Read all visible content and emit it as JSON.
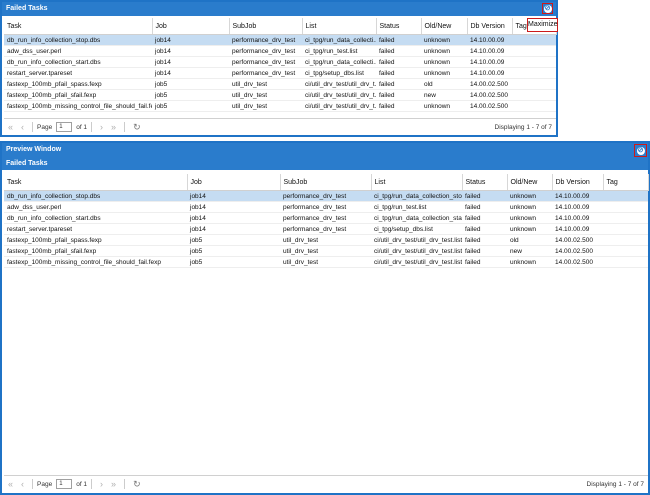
{
  "colors": {
    "accent": "#2a7ccc",
    "highlight": "#cc1a1a",
    "selected_row": "#c5dcf2"
  },
  "icons": {
    "close": "close-icon",
    "first": "first-page-icon",
    "prev": "prev-page-icon",
    "next": "next-page-icon",
    "last": "last-page-icon",
    "refresh": "refresh-icon"
  },
  "window1": {
    "title": "Failed Tasks",
    "tooltip": "Maximize",
    "columns": [
      "Task",
      "Job",
      "SubJob",
      "List",
      "Status",
      "Old/New",
      "Db Version",
      "Tag"
    ],
    "rows": [
      [
        "db_run_info_collection_stop.dbs",
        "job14",
        "performance_drv_test",
        "ci_tpg/run_data_collecti...",
        "failed",
        "unknown",
        "14.10.00.09",
        ""
      ],
      [
        "adw_dss_user.perl",
        "job14",
        "performance_drv_test",
        "ci_tpg/run_test.list",
        "failed",
        "unknown",
        "14.10.00.09",
        ""
      ],
      [
        "db_run_info_collection_start.dbs",
        "job14",
        "performance_drv_test",
        "ci_tpg/run_data_collecti...",
        "failed",
        "unknown",
        "14.10.00.09",
        ""
      ],
      [
        "restart_server.tpareset",
        "job14",
        "performance_drv_test",
        "ci_tpg/setup_dbs.list",
        "failed",
        "unknown",
        "14.10.00.09",
        ""
      ],
      [
        "fastexp_100mb_pfail_spass.fexp",
        "job5",
        "util_drv_test",
        "ci/util_drv_test/util_drv_t...",
        "failed",
        "old",
        "14.00.02.500",
        ""
      ],
      [
        "fastexp_100mb_pfail_sfail.fexp",
        "job5",
        "util_drv_test",
        "ci/util_drv_test/util_drv_t...",
        "failed",
        "new",
        "14.00.02.500",
        ""
      ],
      [
        "fastexp_100mb_missing_control_file_should_fail.fexp",
        "job5",
        "util_drv_test",
        "ci/util_drv_test/util_drv_t...",
        "failed",
        "unknown",
        "14.00.02.500",
        ""
      ]
    ],
    "pager": {
      "page_label": "Page",
      "page_value": "1",
      "of_label": "of 1",
      "display_text": "Displaying 1 - 7 of 7"
    }
  },
  "window2": {
    "title": "Preview Window",
    "subtitle": "Failed Tasks",
    "columns": [
      "Task",
      "Job",
      "SubJob",
      "List",
      "Status",
      "Old/New",
      "Db Version",
      "Tag"
    ],
    "rows": [
      [
        "db_run_info_collection_stop.dbs",
        "job14",
        "performance_drv_test",
        "ci_tpg/run_data_collection_sto...",
        "failed",
        "unknown",
        "14.10.00.09",
        ""
      ],
      [
        "adw_dss_user.perl",
        "job14",
        "performance_drv_test",
        "ci_tpg/run_test.list",
        "failed",
        "unknown",
        "14.10.00.09",
        ""
      ],
      [
        "db_run_info_collection_start.dbs",
        "job14",
        "performance_drv_test",
        "ci_tpg/run_data_collection_sta...",
        "failed",
        "unknown",
        "14.10.00.09",
        ""
      ],
      [
        "restart_server.tpareset",
        "job14",
        "performance_drv_test",
        "ci_tpg/setup_dbs.list",
        "failed",
        "unknown",
        "14.10.00.09",
        ""
      ],
      [
        "fastexp_100mb_pfail_spass.fexp",
        "job5",
        "util_drv_test",
        "ci/util_drv_test/util_drv_test.list",
        "failed",
        "old",
        "14.00.02.500",
        ""
      ],
      [
        "fastexp_100mb_pfail_sfail.fexp",
        "job5",
        "util_drv_test",
        "ci/util_drv_test/util_drv_test.list",
        "failed",
        "new",
        "14.00.02.500",
        ""
      ],
      [
        "fastexp_100mb_missing_control_file_should_fail.fexp",
        "job5",
        "util_drv_test",
        "ci/util_drv_test/util_drv_test.list",
        "failed",
        "unknown",
        "14.00.02.500",
        ""
      ]
    ],
    "pager": {
      "page_label": "Page",
      "page_value": "1",
      "of_label": "of 1",
      "display_text": "Displaying 1 - 7 of 7"
    }
  }
}
